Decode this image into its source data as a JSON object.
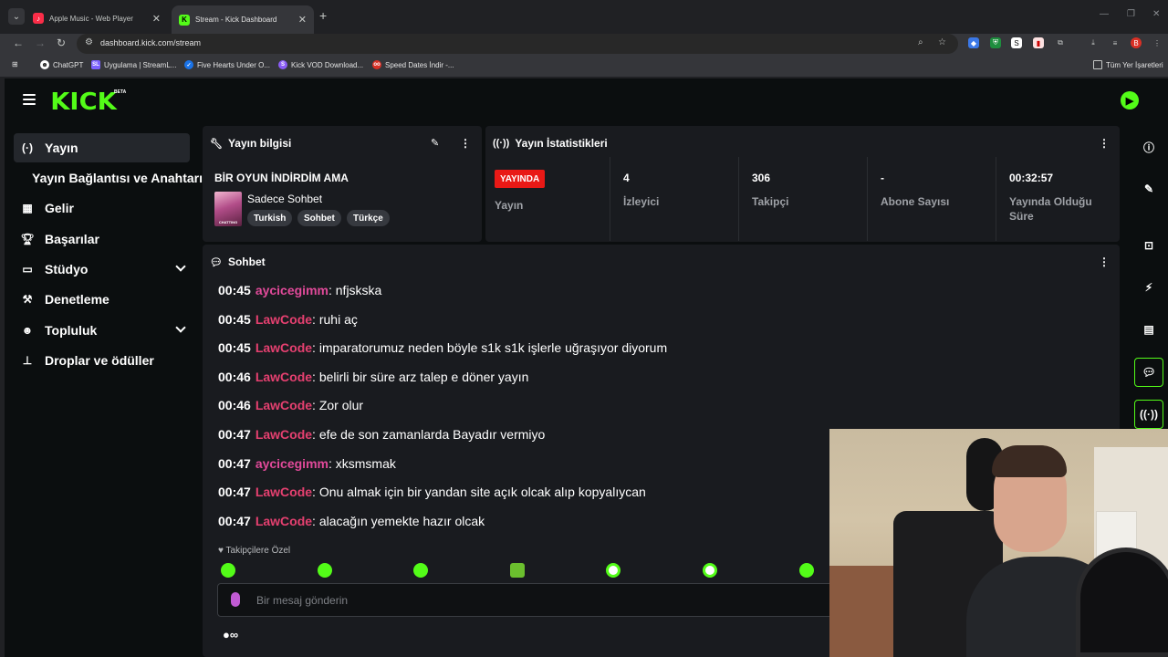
{
  "browser": {
    "tabs": [
      {
        "title": "Apple Music - Web Player",
        "icon": "apple-music-icon",
        "color": "#fa2d48"
      },
      {
        "title": "Stream - Kick Dashboard",
        "icon": "kick-icon",
        "color": "#53fc18"
      }
    ],
    "url": "dashboard.kick.com/stream",
    "bookmarks": [
      {
        "label": "ChatGPT",
        "icon": "chatgpt-icon"
      },
      {
        "label": "Uygulama | StreamL...",
        "icon": "streamlabs-icon"
      },
      {
        "label": "Five Hearts Under O...",
        "icon": "fivehearts-icon"
      },
      {
        "label": "Kick VOD Download...",
        "icon": "kick-vod-icon"
      },
      {
        "label": "Speed Dates İndir -...",
        "icon": "speed-dates-icon"
      }
    ],
    "all_bookmarks": "Tüm Yer İşaretleri"
  },
  "kick": {
    "logo": "KICK",
    "beta": "BETA",
    "sidebar": [
      {
        "label": "Yayın",
        "icon": "broadcast-icon",
        "active": true
      },
      {
        "label": "Yayın Bağlantısı ve Anahtarı",
        "icon": "",
        "active": false
      },
      {
        "label": "Gelir",
        "icon": "revenue-icon",
        "active": false
      },
      {
        "label": "Başarılar",
        "icon": "trophy-icon",
        "active": false
      },
      {
        "label": "Stüdyo",
        "icon": "studio-icon",
        "active": false,
        "expandable": true
      },
      {
        "label": "Denetleme",
        "icon": "hammer-icon",
        "active": false
      },
      {
        "label": "Topluluk",
        "icon": "community-icon",
        "active": false,
        "expandable": true
      },
      {
        "label": "Droplar ve ödüller",
        "icon": "drops-icon",
        "active": false
      }
    ],
    "stream_info": {
      "title": "Yayın bilgisi",
      "stream_title": "BİR OYUN İNDİRDİM AMA",
      "category": "Sadece Sohbet",
      "thumb_label": "CHATTING",
      "tags": [
        "Turkish",
        "Sohbet",
        "Türkçe"
      ]
    },
    "stats": {
      "title": "Yayın İstatistikleri",
      "live_badge": "YAYINDA",
      "items": [
        {
          "value": "",
          "label": "Yayın"
        },
        {
          "value": "4",
          "label": "İzleyici"
        },
        {
          "value": "306",
          "label": "Takipçi"
        },
        {
          "value": "-",
          "label": "Abone Sayısı"
        },
        {
          "value": "00:32:57",
          "label": "Yayında Olduğu Süre"
        }
      ]
    },
    "chat": {
      "title": "Sohbet",
      "messages": [
        {
          "time": "00:45",
          "user": "aycicegimm",
          "text": "nfjskska",
          "color": "#e14a9a"
        },
        {
          "time": "00:45",
          "user": "LawCode",
          "text": "ruhi aç",
          "color": "#e54070"
        },
        {
          "time": "00:45",
          "user": "LawCode",
          "text": "imparatorumuz neden böyle s1k s1k işlerle uğraşıyor diyorum",
          "color": "#e54070"
        },
        {
          "time": "00:46",
          "user": "LawCode",
          "text": "belirli bir süre arz talep e döner yayın",
          "color": "#e54070"
        },
        {
          "time": "00:46",
          "user": "LawCode",
          "text": "Zor olur",
          "color": "#e54070"
        },
        {
          "time": "00:47",
          "user": "LawCode",
          "text": "efe de son zamanlarda Bayadır vermiyo",
          "color": "#e54070"
        },
        {
          "time": "00:47",
          "user": "aycicegimm",
          "text": "xksmsmak",
          "color": "#e14a9a"
        },
        {
          "time": "00:47",
          "user": "LawCode",
          "text": "Onu almak için bir yandan site açık olcak alıp kopyalıycan",
          "color": "#e54070"
        },
        {
          "time": "00:47",
          "user": "LawCode",
          "text": "alacağın yemekte hazır olcak",
          "color": "#e54070"
        }
      ],
      "followers_only": "Takipçilere Özel",
      "placeholder": "Bir mesaj gönderin"
    }
  }
}
